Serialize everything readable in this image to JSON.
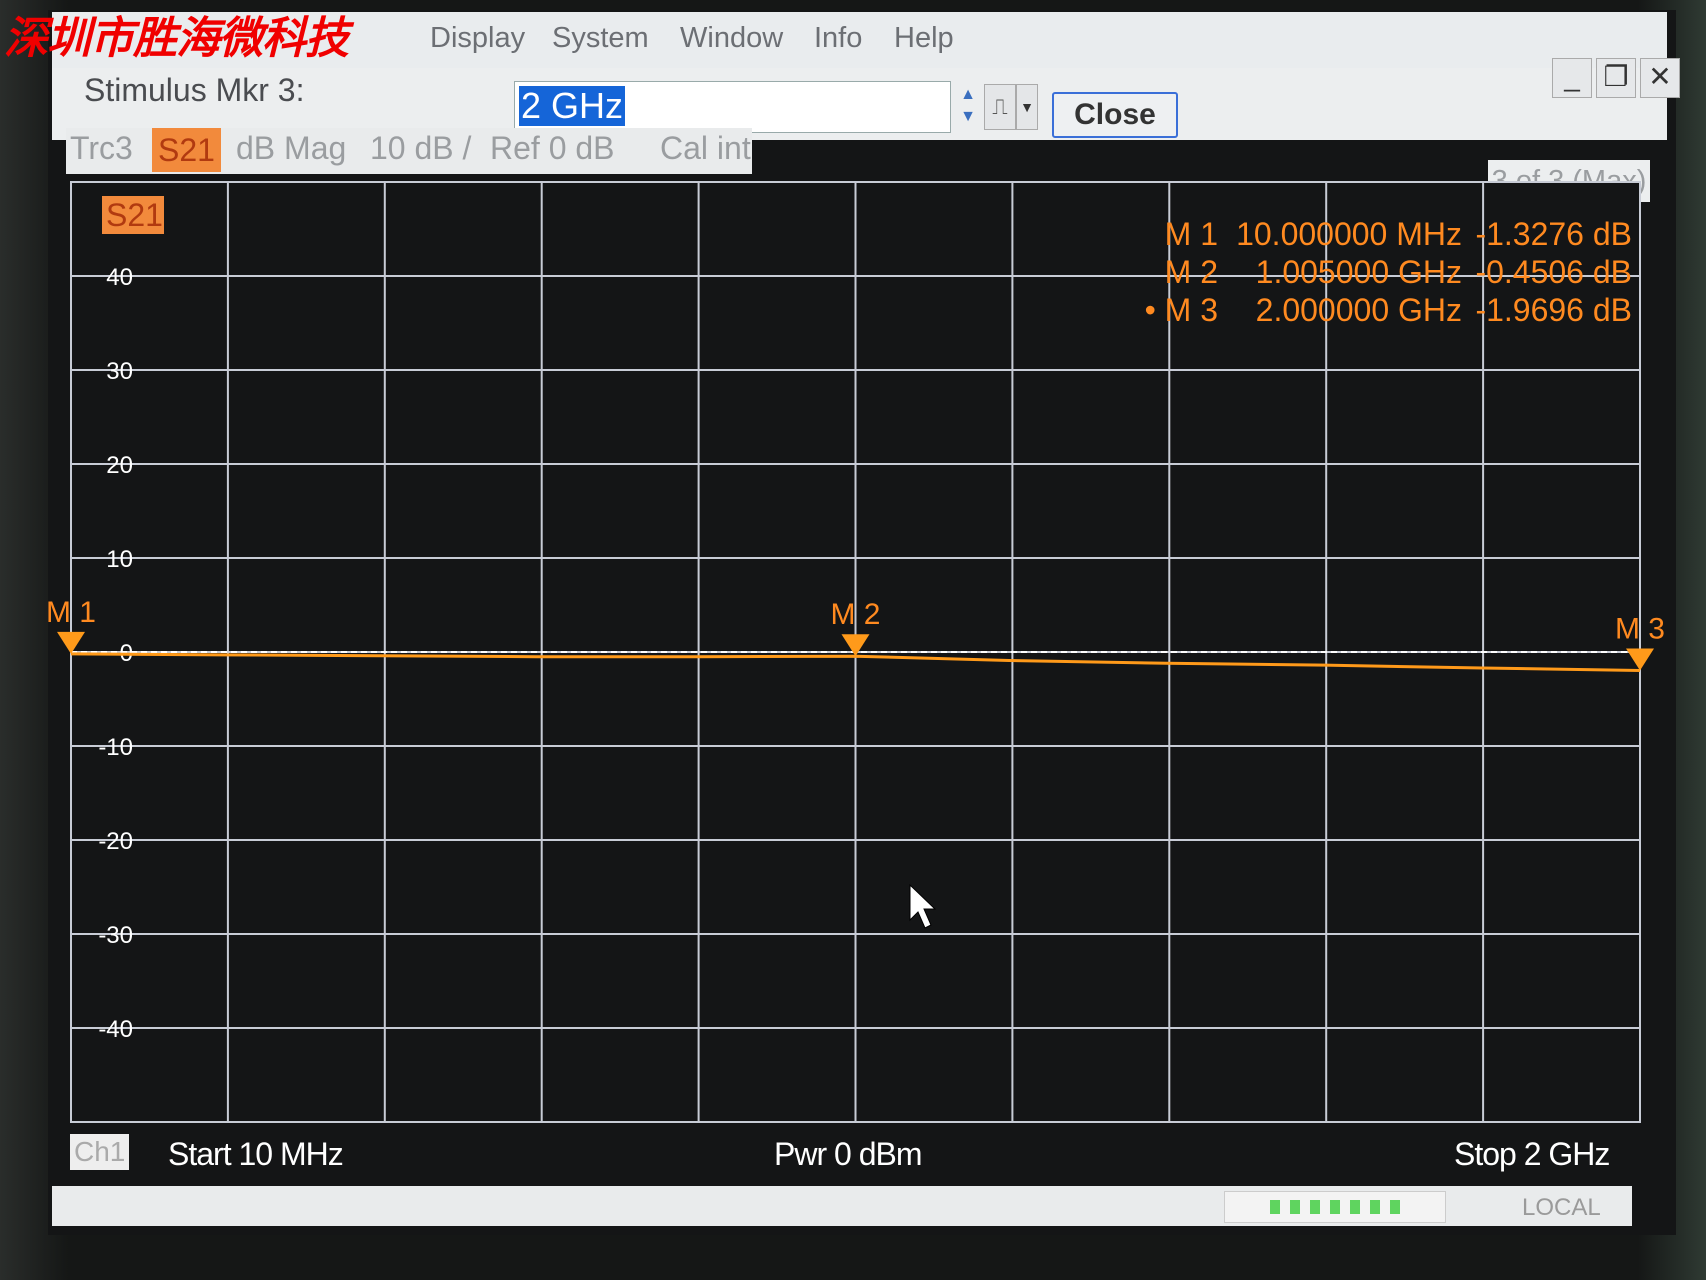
{
  "watermark": "深圳市胜海微科技",
  "menu": [
    "Display",
    "System",
    "Window",
    "Info",
    "Help"
  ],
  "window_buttons": {
    "minimize": "_",
    "restore": "❐",
    "close": "✕"
  },
  "stimulus": {
    "label": "Stimulus Mkr 3:",
    "value": "2 GHz",
    "close_label": "Close"
  },
  "trace_header": {
    "trace": "Trc3",
    "param": "S21",
    "format": "dB Mag",
    "scale": "10 dB /",
    "ref": "Ref 0 dB",
    "cal": "Cal int"
  },
  "marker_count": "3 of 3 (Max)",
  "plot_tag": "S21",
  "footer": {
    "channel": "Ch1",
    "start": "Start  10 MHz",
    "power": "Pwr  0 dBm",
    "stop": "Stop  2 GHz"
  },
  "status": {
    "local": "LOCAL",
    "led_count": 7
  },
  "colors": {
    "trace": "#ff9a1a",
    "marker_text": "#ff8a20",
    "grid": "#c8ccd6",
    "background": "#141516",
    "selection": "#1565d8"
  },
  "chart_data": {
    "type": "line",
    "xlabel": "",
    "ylabel": "",
    "xlim_mhz": [
      10,
      2000
    ],
    "ylim": [
      -50,
      50
    ],
    "yticks": [
      40,
      30,
      20,
      10,
      0,
      -10,
      -20,
      -30,
      -40
    ],
    "ytick_labels": [
      "40",
      "30",
      "20",
      "10",
      "0",
      "-10",
      "-20",
      "-30",
      "-40"
    ],
    "x_divisions": 10,
    "grid": true,
    "series": [
      {
        "x_mhz": [
          10,
          200,
          400,
          600,
          800,
          1005,
          1200,
          1400,
          1600,
          1800,
          2000
        ],
        "y_db": [
          -0.2,
          -0.3,
          -0.4,
          -0.5,
          -0.5,
          -0.45,
          -0.9,
          -1.2,
          -1.4,
          -1.7,
          -1.97
        ]
      }
    ],
    "markers": [
      {
        "label": "M 1",
        "x_mhz": 10,
        "freq": "10.000000 MHz",
        "value": "-1.3276 dB",
        "active": false
      },
      {
        "label": "M 2",
        "x_mhz": 1005,
        "freq": "1.005000 GHz",
        "value": "-0.4506 dB",
        "active": false
      },
      {
        "label": "M 3",
        "x_mhz": 2000,
        "freq": "2.000000 GHz",
        "value": "-1.9696 dB",
        "active": true
      }
    ]
  }
}
